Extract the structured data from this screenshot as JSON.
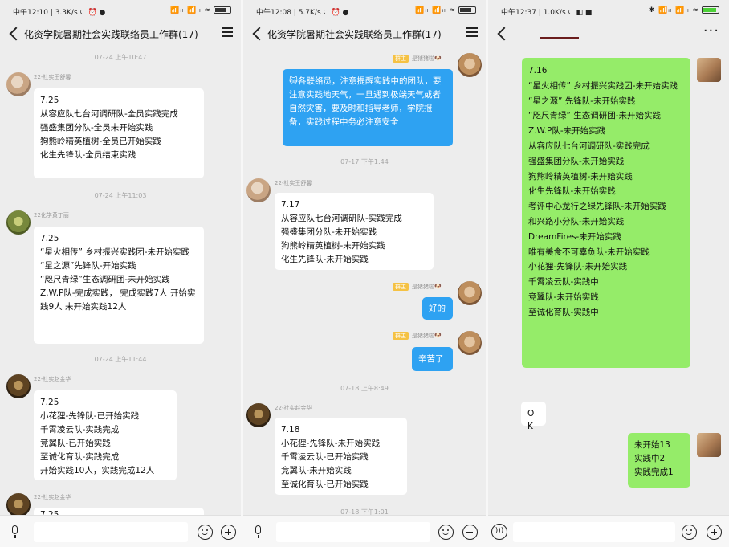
{
  "panel1": {
    "status": {
      "left": "中午12:10 | 3.3K/s ⏾ ⏰ ●",
      "right": "📶ᵢₗ 📶ᵢₗ ≈"
    },
    "title": "化资学院暑期社会实践联络员工作群(17)",
    "timestamps": [
      "07-24 上午10:47",
      "07-24 上午11:03",
      "07-24 上午11:44"
    ],
    "messages": [
      {
        "sender": "22-社实王舒馨",
        "text": "7.25\n从容应队七台河调研队-全员实践完成\n强盛集团分队-全员未开始实践\n狗熊岭精英植树-全员已开始实践\n化生先锋队-全员结束实践"
      },
      {
        "sender": "22化学黄丁丽",
        "text": "7.25\n“星火相传” 乡村振兴实践团-未开始实践\n“星之源”先锋队-开始实践\n“咫尺青绿”生态调研团-未开始实践\nZ.W.P队-完成实践， 完成实践7人 开始实践9人 未开始实践12人"
      },
      {
        "sender": "22-社实赵金华",
        "text": "7.25\n小花狸-先锋队-已开始实践\n千霄凌云队-实践完成\n竞翼队-已开始实践\n至诚化育队-实践完成\n开始实践10人，实践完成12人"
      },
      {
        "sender": "22-社实赵金华",
        "text": "7.25"
      }
    ]
  },
  "panel2": {
    "status": {
      "left": "中午12:08 | 5.7K/s ⏾ ⏰ ●",
      "right": "📶ᵢₗ 📶ᵢₗ ≈"
    },
    "title": "化资学院暑期社会实践联络员工作群(17)",
    "tag": "群主",
    "owner_name": "是猪猪啦🐶",
    "announcement": "🐱各联络员，注意提醒实践中的团队，要注意实践地天气，一旦遇到极端天气或者自然灾害，要及时和指导老师，学院报备，实践过程中务必注意安全",
    "timestamps": [
      "07-17 下午1:44",
      "07-18 上午8:49",
      "07-18 下午1:01"
    ],
    "msg717": {
      "sender": "22-社实王舒馨",
      "text": "7.17\n从容应队七台河调研队-实践完成\n强盛集团分队-未开始实践\n狗熊岭精英植树-未开始实践\n化生先锋队-未开始实践"
    },
    "reply1": "好的",
    "reply2": "辛苦了",
    "msg718": {
      "sender": "22-社实赵金华",
      "text": "7.18\n小花狸-先锋队-未开始实践\n千霄凌云队-已开始实践\n竞翼队-未开始实践\n至诚化育队-已开始实践"
    }
  },
  "panel3": {
    "status": {
      "left": "中午12:37 | 1.0K/s ⏾ ◧ ■",
      "right": "✱ 📶ᵢₗ 📶ᵢₗ ≈"
    },
    "list": "7.16\n“星火相传” 乡村振兴实践团-未开始实践\n“星之源” 先锋队-未开始实践\n“咫尺青绿” 生态调研团-未开始实践\nZ.W.P队-未开始实践\n从容应队七台河调研队-实践完成\n强盛集团分队-未开始实践\n狗熊岭精英植树-未开始实践\n化生先锋队-未开始实践\n考评中心龙行之绿先锋队-未开始实践\n和兴路小分队-未开始实践\nDreamFires-未开始实践\n唯有美食不可辜负队-未开始实践\n小花狸-先锋队-未开始实践\n千霄凌云队-实践中\n竞翼队-未开始实践\n至诚化育队-实践中",
    "ok": "OK",
    "summary": "未开始13\n实践中2\n实践完成1"
  },
  "icons": {
    "back": "back-arrow-icon",
    "menu": "hamburger-menu-icon",
    "more": "more-dots-icon",
    "mic": "microphone-icon",
    "voice": "voice-wave-icon",
    "emoji": "emoji-icon",
    "plus": "plus-circle-icon"
  },
  "colors": {
    "background": "#ededed",
    "bubble_white": "#ffffff",
    "bubble_blue": "#2ea2f2",
    "bubble_green": "#95ec69",
    "owner_tag": "#f5c244"
  }
}
